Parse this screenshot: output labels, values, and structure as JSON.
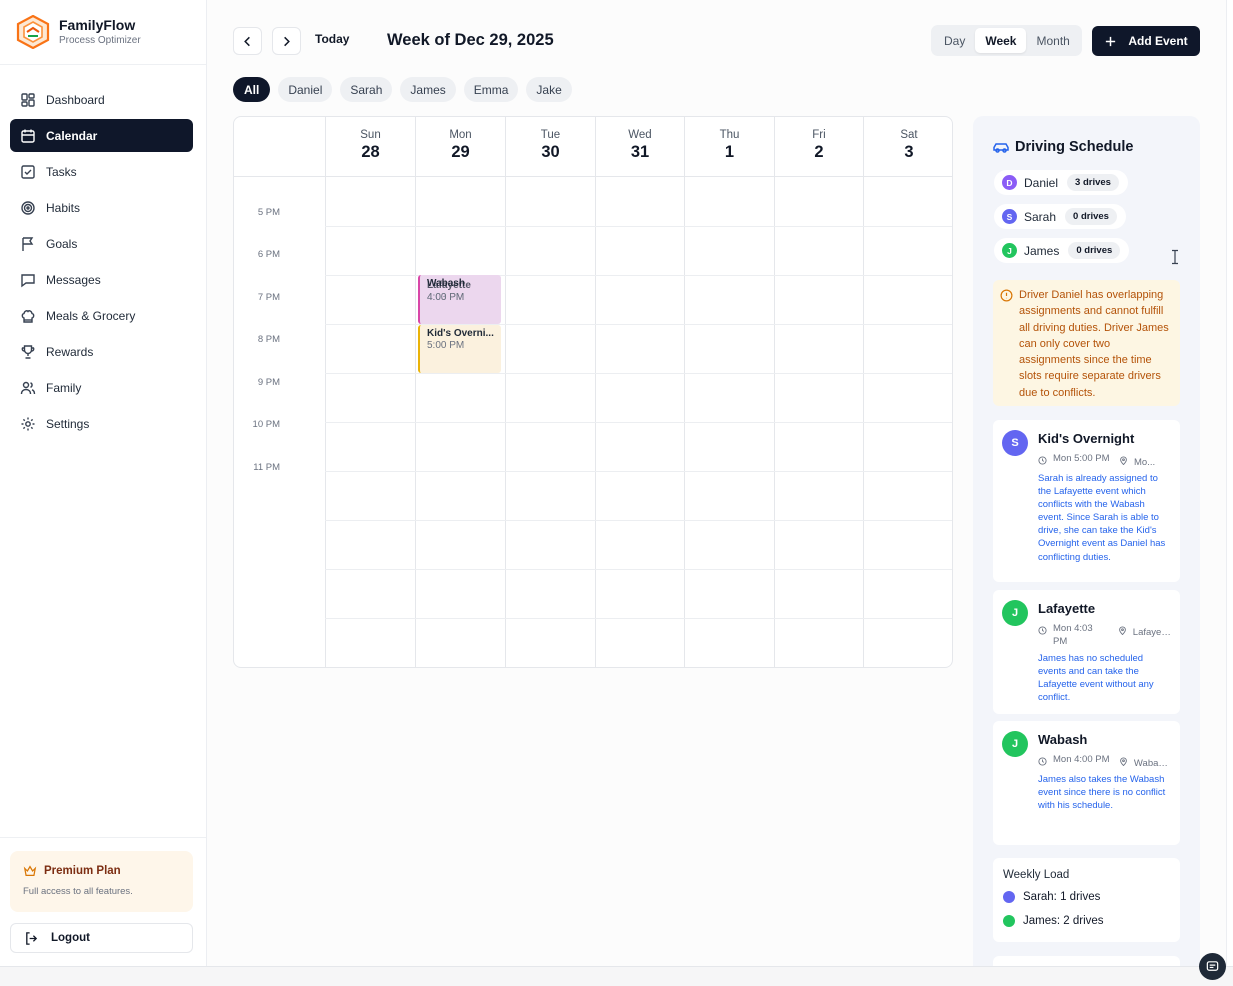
{
  "brand": {
    "name": "FamilyFlow",
    "tagline": "Process Optimizer"
  },
  "nav": [
    {
      "label": "Dashboard",
      "icon": "dashboard-icon"
    },
    {
      "label": "Calendar",
      "icon": "calendar-icon",
      "active": true
    },
    {
      "label": "Tasks",
      "icon": "tasks-icon"
    },
    {
      "label": "Habits",
      "icon": "habits-icon"
    },
    {
      "label": "Goals",
      "icon": "goals-icon"
    },
    {
      "label": "Messages",
      "icon": "messages-icon"
    },
    {
      "label": "Meals & Grocery",
      "icon": "chef-hat-icon"
    },
    {
      "label": "Rewards",
      "icon": "trophy-icon"
    },
    {
      "label": "Family",
      "icon": "family-icon"
    },
    {
      "label": "Settings",
      "icon": "gear-icon"
    }
  ],
  "premium": {
    "title": "Premium Plan",
    "subtitle": "Full access to all features."
  },
  "logout_label": "Logout",
  "toolbar": {
    "today_label": "Today",
    "week_title": "Week of Dec 29, 2025",
    "views": [
      "Day",
      "Week",
      "Month"
    ],
    "active_view": "Week",
    "add_event_label": "Add Event"
  },
  "filters": [
    "All",
    "Daniel",
    "Sarah",
    "James",
    "Emma",
    "Jake"
  ],
  "calendar": {
    "days": [
      {
        "name": "Sun",
        "num": "28"
      },
      {
        "name": "Mon",
        "num": "29"
      },
      {
        "name": "Tue",
        "num": "30"
      },
      {
        "name": "Wed",
        "num": "31"
      },
      {
        "name": "Thu",
        "num": "1"
      },
      {
        "name": "Fri",
        "num": "2"
      },
      {
        "name": "Sat",
        "num": "3"
      }
    ],
    "times": [
      "5 PM",
      "6 PM",
      "7 PM",
      "8 PM",
      "9 PM",
      "10 PM",
      "11 PM"
    ],
    "events": [
      {
        "title_a": "Wabash",
        "title_b": "Lafayette",
        "time_a": "4:00 PM",
        "time_b": "4:03 PM"
      },
      {
        "title": "Kid's Overni...",
        "time": "5:00 PM"
      }
    ]
  },
  "driving": {
    "title": "Driving Schedule",
    "drivers": [
      {
        "initial": "D",
        "name": "Daniel",
        "drives": "3 drives",
        "color": "#8b5cf6"
      },
      {
        "initial": "S",
        "name": "Sarah",
        "drives": "0 drives",
        "color": "#6366f1"
      },
      {
        "initial": "J",
        "name": "James",
        "drives": "0 drives",
        "color": "#22c55e"
      }
    ],
    "warning": "Driver Daniel has overlapping assignments and cannot fulfill all driving duties. Driver James can only cover two assignments since the time slots require separate drivers due to conflicts.",
    "assignments": [
      {
        "initial": "S",
        "color": "#6366f1",
        "title": "Kid's Overnight",
        "time": "Mon 5:00 PM",
        "location": "Mo...",
        "note": "Sarah is already assigned to the Lafayette event which conflicts with the Wabash event. Since Sarah is able to drive, she can take the Kid's Overnight event as Daniel has conflicting duties."
      },
      {
        "initial": "J",
        "color": "#22c55e",
        "title": "Lafayette",
        "time": "Mon 4:03 PM",
        "location": "Lafayet...",
        "note": "James has no scheduled events and can take the Lafayette event without any conflict."
      },
      {
        "initial": "J",
        "color": "#22c55e",
        "title": "Wabash",
        "time": "Mon 4:00 PM",
        "location": "Wabas...",
        "note": "James also takes the Wabash event since there is no conflict with his schedule."
      }
    ],
    "weekly": {
      "title": "Weekly Load",
      "rows": [
        {
          "label": "Sarah: 1 drives",
          "color": "#6366f1"
        },
        {
          "label": "James: 2 drives",
          "color": "#22c55e"
        }
      ]
    }
  }
}
